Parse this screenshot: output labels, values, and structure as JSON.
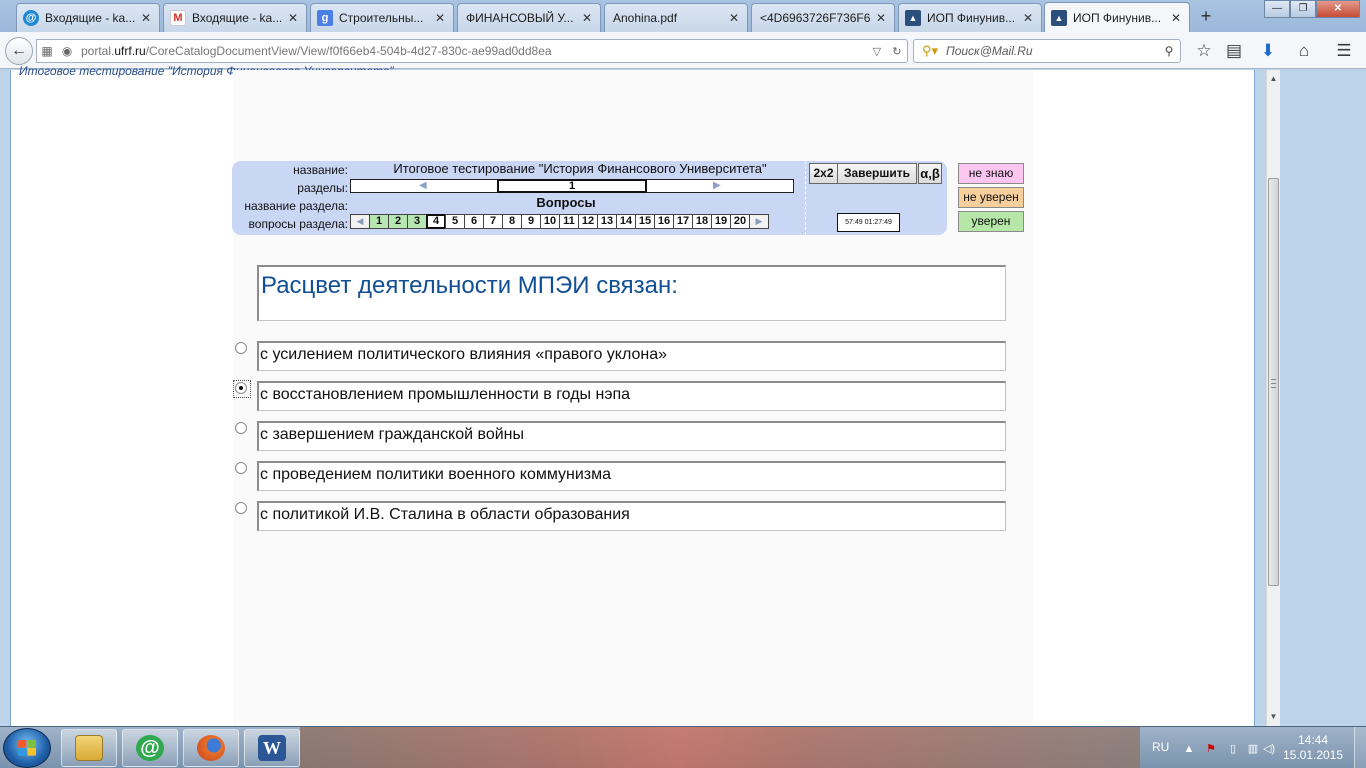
{
  "browser": {
    "tabs": [
      {
        "label": "Входящие - ka...",
        "icon": "mail-ru-icon",
        "color": "#1e88d6",
        "glyph": "@"
      },
      {
        "label": "Входящие - ka...",
        "icon": "gmail-icon",
        "color": "#d93025",
        "glyph": "M"
      },
      {
        "label": "Строительны...",
        "icon": "google-icon",
        "color": "#4a7fe6",
        "glyph": "g"
      },
      {
        "label": "ФИНАНСОВЫЙ У...",
        "icon": "page-icon",
        "color": "#c7d6e9",
        "glyph": ""
      },
      {
        "label": "Anohina.pdf",
        "icon": "pdf-icon",
        "color": "#c7d6e9",
        "glyph": ""
      },
      {
        "label": "<4D6963726F736F6...",
        "icon": "page-icon",
        "color": "#c7d6e9",
        "glyph": ""
      },
      {
        "label": "ИОП Финунив...",
        "icon": "graduation-cap-icon",
        "color": "#2a4f7c",
        "glyph": "▲"
      },
      {
        "label": "ИОП Финунив...",
        "icon": "graduation-cap-icon",
        "color": "#2a4f7c",
        "glyph": "▲"
      }
    ],
    "active_tab": 7,
    "new_tab": "+",
    "window_controls": {
      "minimize": "—",
      "maximize": "❐",
      "close": "✕"
    },
    "url_host": "portal.",
    "url_domain": "ufrf.ru",
    "url_path": "/CoreCatalogDocumentView/View/f0f66eb4-504b-4d27-830c-ae99ad0dd8ea",
    "search_placeholder": "Поиск@Mail.Ru"
  },
  "page": {
    "breadcrumb": "Итоговое тестирование \"История Финансового Университета\"",
    "panel": {
      "name_label": "название:",
      "name_value": "Итоговое тестирование \"История Финансового Университета\"",
      "sections_label": "разделы:",
      "current_section": "1",
      "section_name_label": "название раздела:",
      "section_name_value": "Вопросы",
      "questions_label": "вопросы раздела:",
      "questions": [
        "1",
        "2",
        "3",
        "4",
        "5",
        "6",
        "7",
        "8",
        "9",
        "10",
        "11",
        "12",
        "13",
        "14",
        "15",
        "16",
        "17",
        "18",
        "19",
        "20"
      ],
      "answered": [
        1,
        2,
        3
      ],
      "current_question": 4,
      "calc_button": "2x2",
      "finish_button": "Завершить",
      "symbols_button": "α,β",
      "timer": "57:49  01:27:49"
    },
    "confidence": {
      "dont_know": "не знаю",
      "not_sure": "не уверен",
      "sure": "уверен",
      "colors": {
        "dont_know": "#fcc6f1",
        "not_sure": "#f7cf9c",
        "sure": "#b6e6a8"
      }
    },
    "question": "Расцвет деятельности МПЭИ связан:",
    "options": [
      "с усилением политического влияния «правого уклона»",
      "с восстановлением промышленности в годы нэпа",
      "с завершением гражданской войны",
      "с проведением политики военного коммунизма",
      "с политикой И.В. Сталина в области образования"
    ],
    "selected_option": 2
  },
  "taskbar": {
    "apps": [
      {
        "name": "explorer-icon",
        "color": "#e6b94a"
      },
      {
        "name": "mail-agent-icon",
        "color": "#2fa84f",
        "glyph": "@"
      },
      {
        "name": "firefox-icon",
        "color": "#e8702a"
      },
      {
        "name": "word-icon",
        "color": "#2b5797",
        "glyph": "W"
      }
    ],
    "language": "RU",
    "time": "14:44",
    "date": "15.01.2015"
  }
}
